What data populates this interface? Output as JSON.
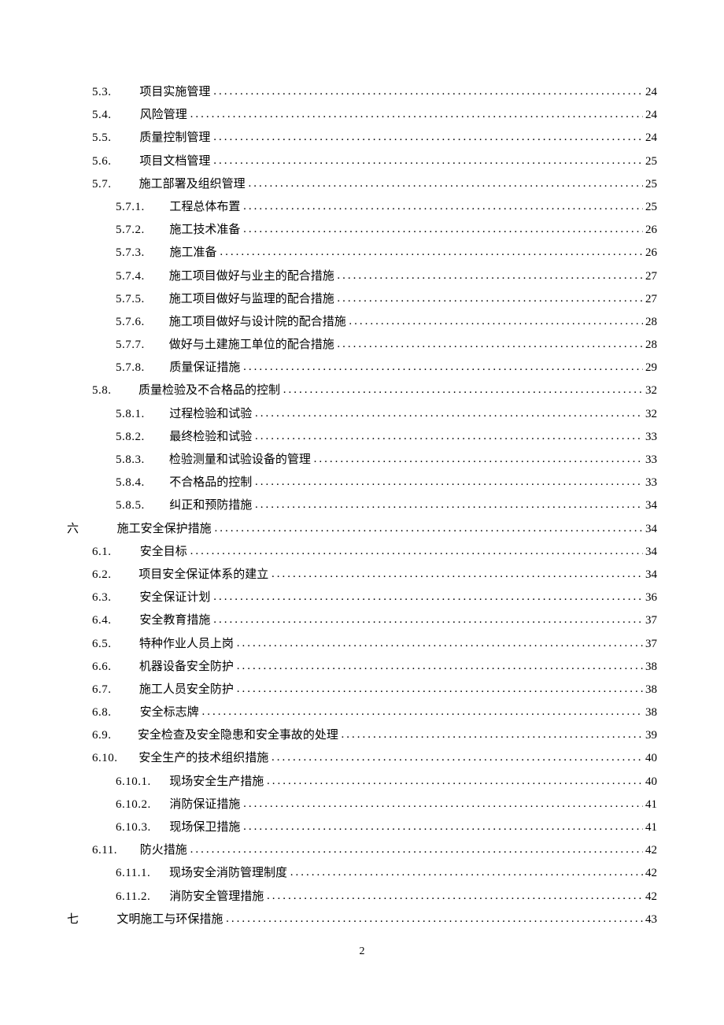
{
  "page_number": "2",
  "toc": [
    {
      "level": 1,
      "num": "5.3.",
      "title": "项目实施管理",
      "page": "24"
    },
    {
      "level": 1,
      "num": "5.4.",
      "title": "风险管理",
      "page": "24"
    },
    {
      "level": 1,
      "num": "5.5.",
      "title": "质量控制管理",
      "page": "24"
    },
    {
      "level": 1,
      "num": "5.6.",
      "title": "项目文档管理",
      "page": "25"
    },
    {
      "level": 1,
      "num": "5.7.",
      "title": "施工部署及组织管理",
      "page": "25"
    },
    {
      "level": 2,
      "num": "5.7.1.",
      "title": "工程总体布置",
      "page": "25"
    },
    {
      "level": 2,
      "num": "5.7.2.",
      "title": "施工技术准备",
      "page": "26"
    },
    {
      "level": 2,
      "num": "5.7.3.",
      "title": "施工准备",
      "page": "26"
    },
    {
      "level": 2,
      "num": "5.7.4.",
      "title": "施工项目做好与业主的配合措施",
      "page": "27"
    },
    {
      "level": 2,
      "num": "5.7.5.",
      "title": "施工项目做好与监理的配合措施",
      "page": "27"
    },
    {
      "level": 2,
      "num": "5.7.6.",
      "title": "施工项目做好与设计院的配合措施",
      "page": "28"
    },
    {
      "level": 2,
      "num": "5.7.7.",
      "title": "做好与土建施工单位的配合措施",
      "page": "28"
    },
    {
      "level": 2,
      "num": "5.7.8.",
      "title": "质量保证措施",
      "page": "29"
    },
    {
      "level": 1,
      "num": "5.8.",
      "title": "质量检验及不合格品的控制",
      "page": "32"
    },
    {
      "level": 2,
      "num": "5.8.1.",
      "title": "过程检验和试验",
      "page": "32"
    },
    {
      "level": 2,
      "num": "5.8.2.",
      "title": "最终检验和试验",
      "page": "33"
    },
    {
      "level": 2,
      "num": "5.8.3.",
      "title": "检验测量和试验设备的管理",
      "page": "33"
    },
    {
      "level": 2,
      "num": "5.8.4.",
      "title": "不合格品的控制",
      "page": "33"
    },
    {
      "level": 2,
      "num": "5.8.5.",
      "title": "纠正和预防措施",
      "page": "34"
    },
    {
      "level": 0,
      "num": "六",
      "title": "施工安全保护措施",
      "page": "34"
    },
    {
      "level": 1,
      "num": "6.1.",
      "title": "安全目标",
      "page": "34"
    },
    {
      "level": 1,
      "num": "6.2.",
      "title": "项目安全保证体系的建立",
      "page": "34"
    },
    {
      "level": 1,
      "num": "6.3.",
      "title": "安全保证计划",
      "page": "36"
    },
    {
      "level": 1,
      "num": "6.4.",
      "title": "安全教育措施",
      "page": "37"
    },
    {
      "level": 1,
      "num": "6.5.",
      "title": "特种作业人员上岗",
      "page": "37"
    },
    {
      "level": 1,
      "num": "6.6.",
      "title": "机器设备安全防护",
      "page": "38"
    },
    {
      "level": 1,
      "num": "6.7.",
      "title": "施工人员安全防护",
      "page": "38"
    },
    {
      "level": 1,
      "num": "6.8.",
      "title": "安全标志牌",
      "page": "38"
    },
    {
      "level": 1,
      "num": "6.9.",
      "title": "安全检查及安全隐患和安全事故的处理",
      "page": "39"
    },
    {
      "level": 1,
      "num": "6.10.",
      "title": "安全生产的技术组织措施",
      "page": "40"
    },
    {
      "level": 2,
      "num": "6.10.1.",
      "title": "现场安全生产措施",
      "page": "40"
    },
    {
      "level": 2,
      "num": "6.10.2.",
      "title": "消防保证措施",
      "page": "41"
    },
    {
      "level": 2,
      "num": "6.10.3.",
      "title": "现场保卫措施",
      "page": "41"
    },
    {
      "level": 1,
      "num": "6.11.",
      "title": "防火措施",
      "page": "42"
    },
    {
      "level": 2,
      "num": "6.11.1.",
      "title": "现场安全消防管理制度",
      "page": "42"
    },
    {
      "level": 2,
      "num": "6.11.2.",
      "title": "消防安全管理措施",
      "page": "42"
    },
    {
      "level": 0,
      "num": "七",
      "title": "文明施工与环保措施",
      "page": "43"
    }
  ]
}
